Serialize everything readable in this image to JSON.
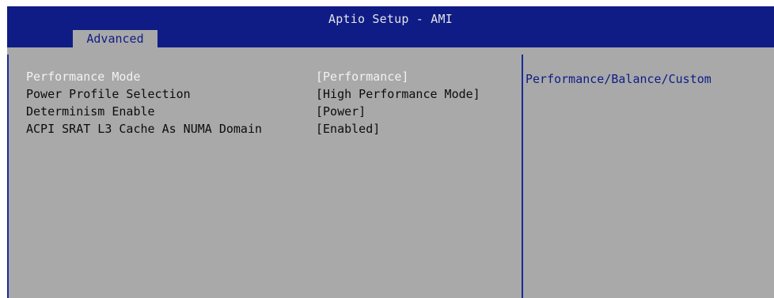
{
  "header": {
    "title": "Aptio Setup - AMI",
    "active_tab": "Advanced"
  },
  "settings": [
    {
      "label": "Performance Mode",
      "value": "[Performance]",
      "selected": true
    },
    {
      "label": "Power Profile Selection",
      "value": "[High Performance Mode]",
      "selected": false
    },
    {
      "label": "Determinism Enable",
      "value": "[Power]",
      "selected": false
    },
    {
      "label": "ACPI SRAT L3 Cache As NUMA Domain",
      "value": "[Enabled]",
      "selected": false
    }
  ],
  "help": {
    "text": "Performance/Balance/Custom"
  },
  "colors": {
    "header_blue": "#0f1c86",
    "panel_gray": "#a9a9a9",
    "selected_text": "#f2f2f2",
    "normal_text": "#0c0c0c",
    "help_text": "#0f1c86"
  }
}
